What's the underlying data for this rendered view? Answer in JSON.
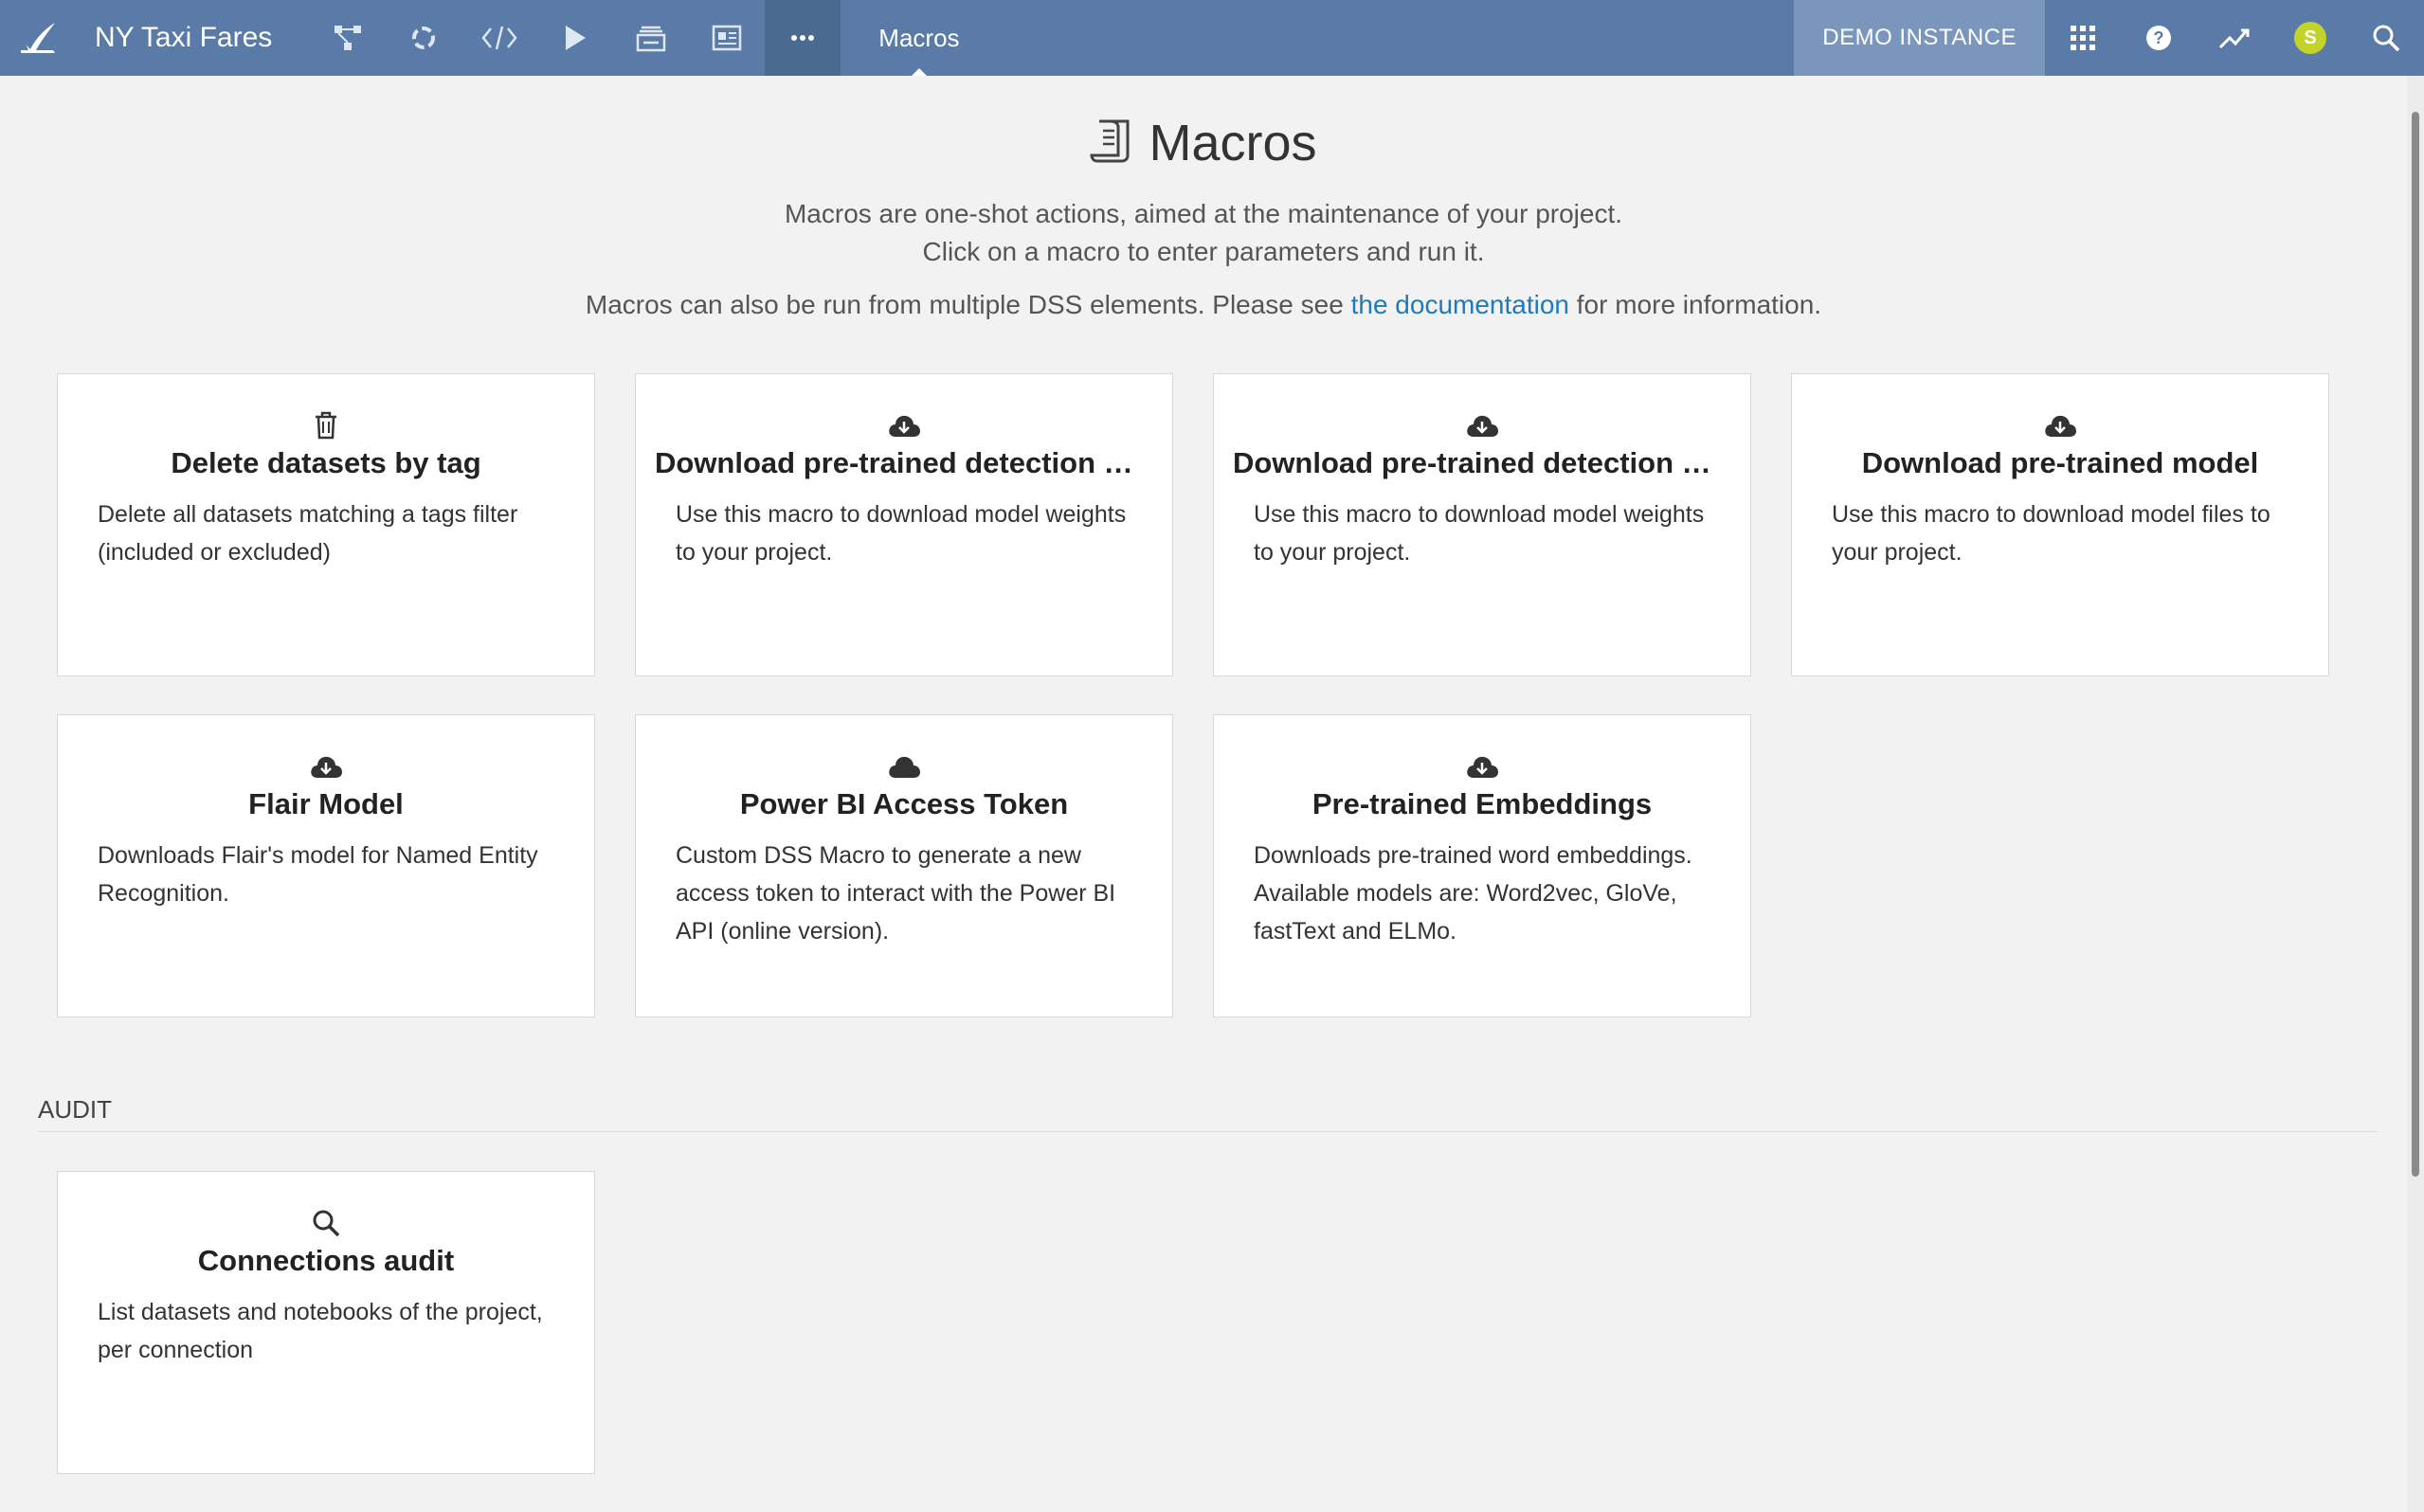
{
  "topbar": {
    "project_name": "NY Taxi Fares",
    "page_label": "Macros",
    "instance_label": "DEMO INSTANCE",
    "avatar_initial": "S",
    "nav_icons": [
      "flow-icon",
      "lab-icon",
      "code-icon",
      "jobs-icon",
      "dashboard-icon",
      "wiki-icon",
      "more-icon"
    ],
    "right_icons": [
      "apps-grid-icon",
      "help-icon",
      "activity-icon",
      "avatar",
      "search-icon"
    ]
  },
  "header": {
    "title": "Macros",
    "line1": "Macros are one-shot actions, aimed at the maintenance of your project.",
    "line2": "Click on a macro to enter parameters and run it.",
    "line3_prefix": "Macros can also be run from multiple DSS elements. Please see ",
    "line3_link": "the documentation",
    "line3_suffix": " for more information."
  },
  "cards": [
    {
      "icon": "trash-icon",
      "title": "Delete datasets by tag",
      "desc": "Delete all datasets matching a tags filter (included or excluded)"
    },
    {
      "icon": "cloud-download-icon",
      "title": "Download pre-trained detection m...",
      "desc": "Use this macro to download model weights to your project."
    },
    {
      "icon": "cloud-download-icon",
      "title": "Download pre-trained detection m...",
      "desc": "Use this macro to download model weights to your project."
    },
    {
      "icon": "cloud-download-icon",
      "title": "Download pre-trained model",
      "desc": "Use this macro to download model files to your project."
    },
    {
      "icon": "cloud-download-icon",
      "title": "Flair Model",
      "desc": "Downloads Flair's model for Named Entity Recognition."
    },
    {
      "icon": "cloud-icon",
      "title": "Power BI Access Token",
      "desc": "Custom DSS Macro to generate a new access token to interact with the Power BI API (online version)."
    },
    {
      "icon": "cloud-download-icon",
      "title": "Pre-trained Embeddings",
      "desc": "Downloads pre-trained word embeddings. Available models are: Word2vec, GloVe, fastText and ELMo."
    }
  ],
  "audit": {
    "section_label": "AUDIT",
    "cards": [
      {
        "icon": "search-icon",
        "title": "Connections audit",
        "desc": "List datasets and notebooks of the project, per connection"
      }
    ]
  }
}
